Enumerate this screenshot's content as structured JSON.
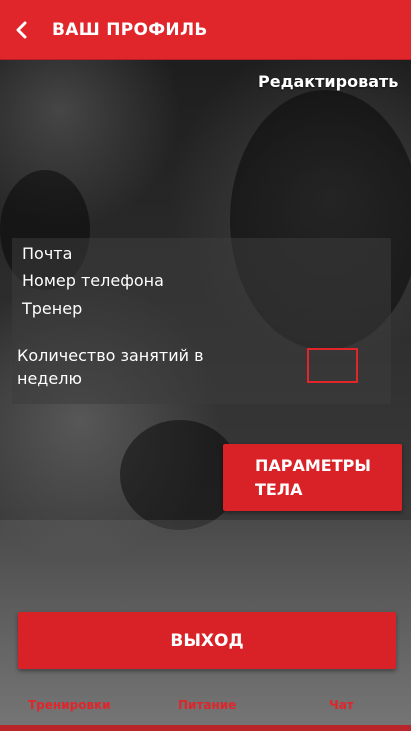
{
  "header": {
    "title": "ВАШ ПРОФИЛЬ",
    "back_icon": "chevron-left-icon",
    "color": "#e0262b"
  },
  "actions": {
    "edit_label": "Редактировать"
  },
  "profile": {
    "email_label": "Почта",
    "phone_label": "Номер телефона",
    "trainer_label": "Тренер",
    "sessions_label": "Количество занятий в неделю",
    "sessions_value": ""
  },
  "buttons": {
    "body_params_label": "ПАРАМЕТРЫ ТЕЛА",
    "exit_label": "ВЫХОД"
  },
  "bottom_nav": {
    "items": [
      {
        "label": "Тренировки"
      },
      {
        "label": "Питание"
      },
      {
        "label": "Чат"
      }
    ]
  }
}
